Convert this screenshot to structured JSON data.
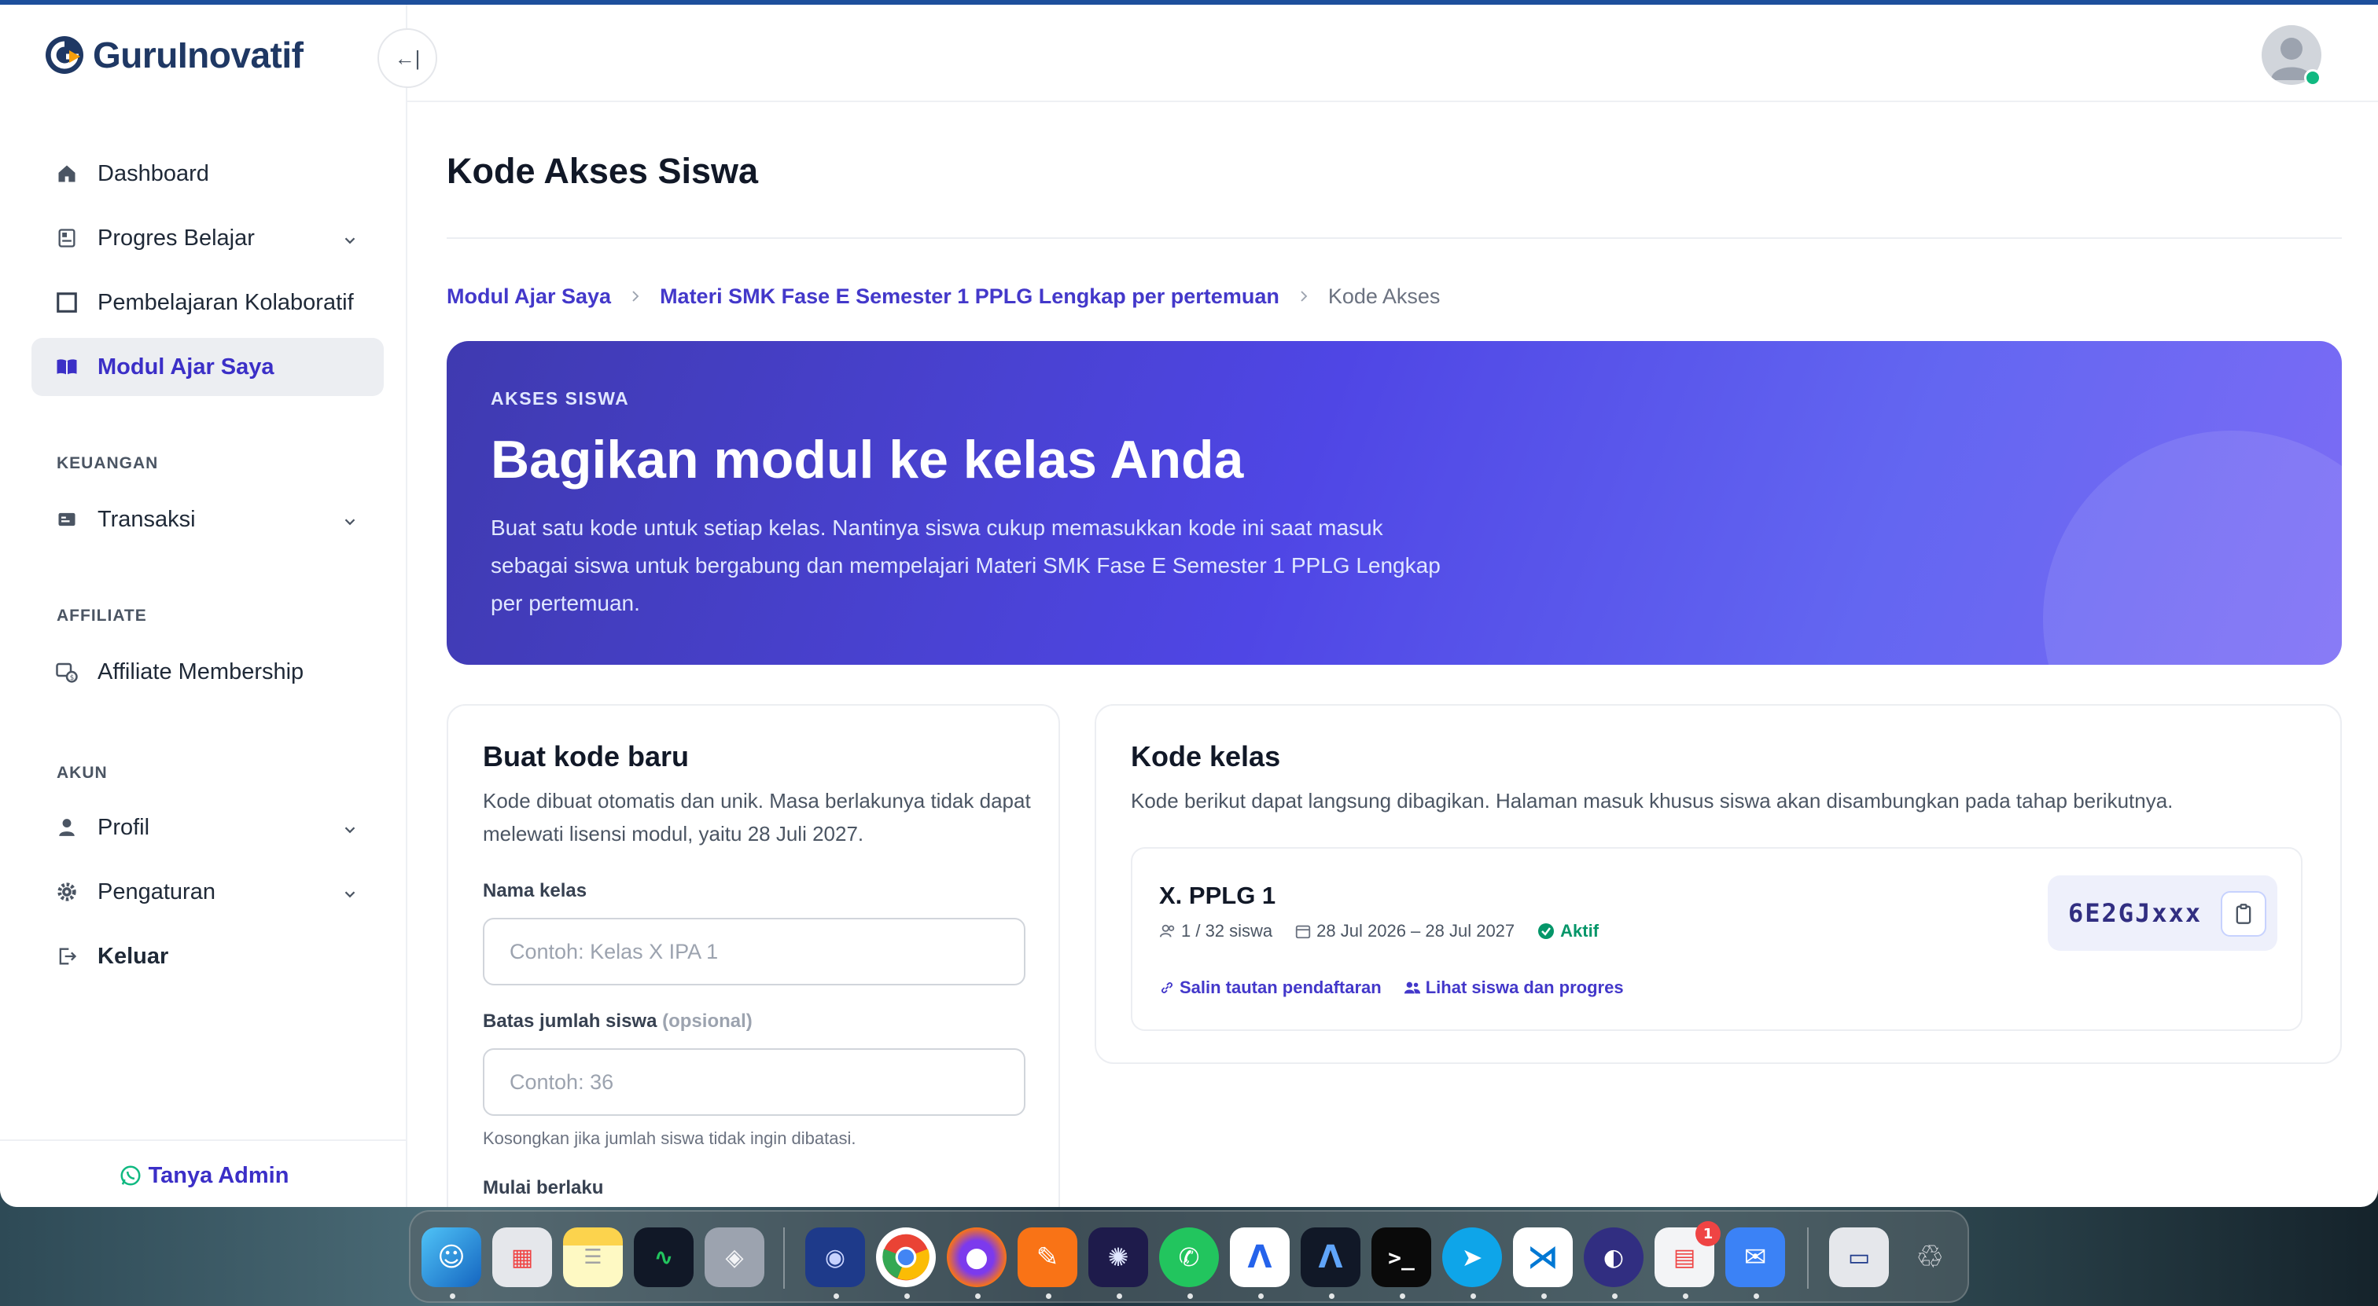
{
  "app": {
    "brand": "GuruInovatif"
  },
  "sidebar": {
    "items": [
      {
        "label": "Dashboard"
      },
      {
        "label": "Progres Belajar"
      },
      {
        "label": "Pembelajaran Kolaboratif"
      },
      {
        "label": "Modul Ajar Saya"
      }
    ],
    "sections": {
      "keuangan": {
        "label": "KEUANGAN",
        "items": [
          {
            "label": "Transaksi"
          }
        ]
      },
      "affiliate": {
        "label": "AFFILIATE",
        "items": [
          {
            "label": "Affiliate Membership"
          }
        ]
      },
      "akun": {
        "label": "AKUN",
        "items": [
          {
            "label": "Profil"
          },
          {
            "label": "Pengaturan"
          },
          {
            "label": "Keluar"
          }
        ]
      }
    },
    "footer": {
      "label": "Tanya Admin"
    },
    "collapse_icon": "←|"
  },
  "page": {
    "title": "Kode Akses Siswa",
    "breadcrumb": [
      "Modul Ajar Saya",
      "Materi SMK Fase E Semester 1 PPLG Lengkap per pertemuan",
      "Kode Akses"
    ]
  },
  "hero": {
    "eyebrow": "AKSES SISWA",
    "title": "Bagikan modul ke kelas Anda",
    "description": "Buat satu kode untuk setiap kelas. Nantinya siswa cukup memasukkan kode ini saat masuk sebagai siswa untuk bergabung dan mempelajari Materi SMK Fase E Semester 1 PPLG Lengkap per pertemuan."
  },
  "create_card": {
    "title": "Buat kode baru",
    "subtitle": "Kode dibuat otomatis dan unik. Masa berlakunya tidak dapat melewati lisensi modul, yaitu 28 Juli 2027.",
    "fields": {
      "class_name": {
        "label": "Nama kelas",
        "placeholder": "Contoh: Kelas X IPA 1"
      },
      "limit": {
        "label": "Batas jumlah siswa",
        "optional": "(opsional)",
        "placeholder": "Contoh: 36",
        "hint": "Kosongkan jika jumlah siswa tidak ingin dibatasi."
      },
      "start": {
        "label": "Mulai berlaku"
      }
    }
  },
  "codes_card": {
    "title": "Kode kelas",
    "subtitle": "Kode berikut dapat langsung dibagikan. Halaman masuk khusus siswa akan disambungkan pada tahap berikutnya.",
    "classes": [
      {
        "name": "X. PPLG 1",
        "students": "1 / 32 siswa",
        "period": "28 Jul 2026 – 28 Jul 2027",
        "status": "Aktif",
        "code": "6E2GJxxx",
        "action_copy_link": "Salin tautan pendaftaran",
        "action_view": "Lihat siswa dan progres"
      }
    ]
  },
  "dock": {
    "badge": "1"
  },
  "colors": {
    "accent": "#4338ca",
    "brand": "#1f3864",
    "success": "#059669"
  }
}
